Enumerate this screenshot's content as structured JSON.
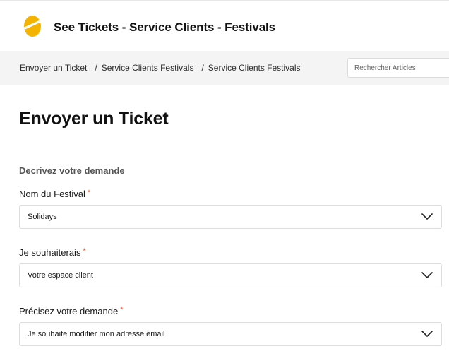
{
  "header": {
    "site_title": "See Tickets - Service Clients - Festivals",
    "logo_icon": "see-tickets-logo-icon",
    "brand_color": "#f5b301"
  },
  "breadcrumb": {
    "items": [
      "Envoyer un Ticket",
      "Service Clients Festivals",
      "Service Clients Festivals"
    ],
    "separator": "/"
  },
  "search": {
    "placeholder": "Rechercher Articles"
  },
  "main": {
    "page_title": "Envoyer un Ticket",
    "section_title": "Decrivez votre demande",
    "required_marker": "*",
    "required_color": "#e35d2f",
    "fields": [
      {
        "label": "Nom du Festival",
        "value": "Solidays",
        "icon": "chevron-down-icon"
      },
      {
        "label": "Je souhaiterais",
        "value": "Votre espace client",
        "icon": "chevron-down-icon"
      },
      {
        "label": "Précisez votre demande",
        "value": "Je souhaite modifier mon adresse email",
        "icon": "chevron-down-icon"
      }
    ]
  }
}
